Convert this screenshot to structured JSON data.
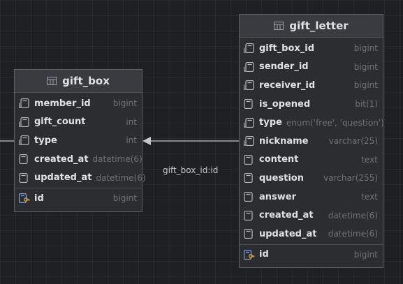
{
  "relationship": {
    "label": "gift_box_id:id"
  },
  "gift_box": {
    "title": "gift_box",
    "columns": [
      {
        "name": "member_id",
        "type": "bigint",
        "icon": "column-icon"
      },
      {
        "name": "gift_count",
        "type": "int",
        "icon": "column-icon"
      },
      {
        "name": "type",
        "type": "int",
        "icon": "column-icon"
      },
      {
        "name": "created_at",
        "type": "datetime(6)",
        "icon": "column-not-null-icon"
      },
      {
        "name": "updated_at",
        "type": "datetime(6)",
        "icon": "column-not-null-icon"
      }
    ],
    "key": {
      "name": "id",
      "type": "bigint",
      "icon": "primary-key-icon"
    }
  },
  "gift_letter": {
    "title": "gift_letter",
    "columns": [
      {
        "name": "gift_box_id",
        "type": "bigint",
        "icon": "column-icon"
      },
      {
        "name": "sender_id",
        "type": "bigint",
        "icon": "column-icon"
      },
      {
        "name": "receiver_id",
        "type": "bigint",
        "icon": "column-icon"
      },
      {
        "name": "is_opened",
        "type": "bit(1)",
        "icon": "column-not-null-icon"
      },
      {
        "name": "type",
        "type": "enum('free', 'question')",
        "icon": "column-icon"
      },
      {
        "name": "nickname",
        "type": "varchar(25)",
        "icon": "column-icon"
      },
      {
        "name": "content",
        "type": "text",
        "icon": "column-not-null-icon"
      },
      {
        "name": "question",
        "type": "varchar(255)",
        "icon": "column-not-null-icon"
      },
      {
        "name": "answer",
        "type": "text",
        "icon": "column-not-null-icon"
      },
      {
        "name": "created_at",
        "type": "datetime(6)",
        "icon": "column-not-null-icon"
      },
      {
        "name": "updated_at",
        "type": "datetime(6)",
        "icon": "column-not-null-icon"
      }
    ],
    "key": {
      "name": "id",
      "type": "bigint",
      "icon": "primary-key-icon"
    }
  },
  "colors": {
    "background": "#1f2023",
    "table_bg": "#2b2d30",
    "header_bg": "#393b40",
    "border": "#5e6167",
    "name_text": "#dfe1e5",
    "type_text": "#6f737a",
    "key_icon": "#d9a33b",
    "pk_blue": "#4a86e8"
  }
}
